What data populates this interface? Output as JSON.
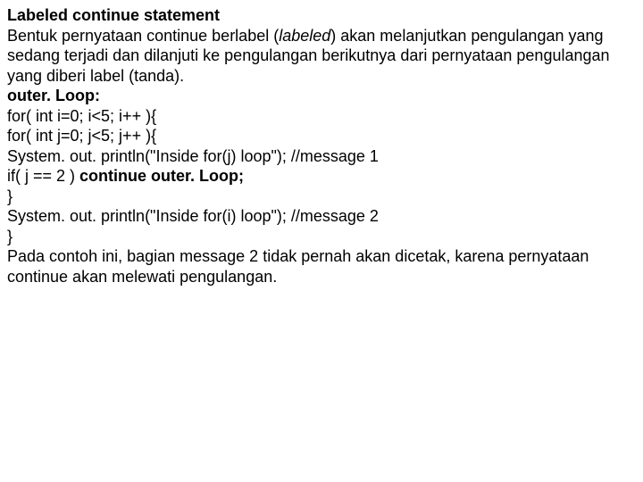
{
  "title": "Labeled continue statement",
  "paragraph1_a": "Bentuk pernyataan continue berlabel (",
  "paragraph1_label": "labeled",
  "paragraph1_b": ") akan melanjutkan pengulangan yang sedang terjadi dan dilanjuti ke pengulangan berikutnya dari pernyataan pengulangan yang diberi label (tanda).",
  "code": {
    "l1": "outer. Loop:",
    "l2": "for( int i=0; i<5; i++ ){",
    "l3": "for( int j=0; j<5; j++ ){",
    "l4": "System. out. println(\"Inside for(j) loop\"); //message 1",
    "l5a": "if( j == 2 ) ",
    "l5b": "continue outer. Loop;",
    "l6": "}",
    "l7": "System. out. println(\"Inside for(i) loop\"); //message 2",
    "l8": "}"
  },
  "paragraph2": "Pada contoh ini, bagian message 2 tidak pernah akan dicetak, karena pernyataan continue akan melewati pengulangan."
}
